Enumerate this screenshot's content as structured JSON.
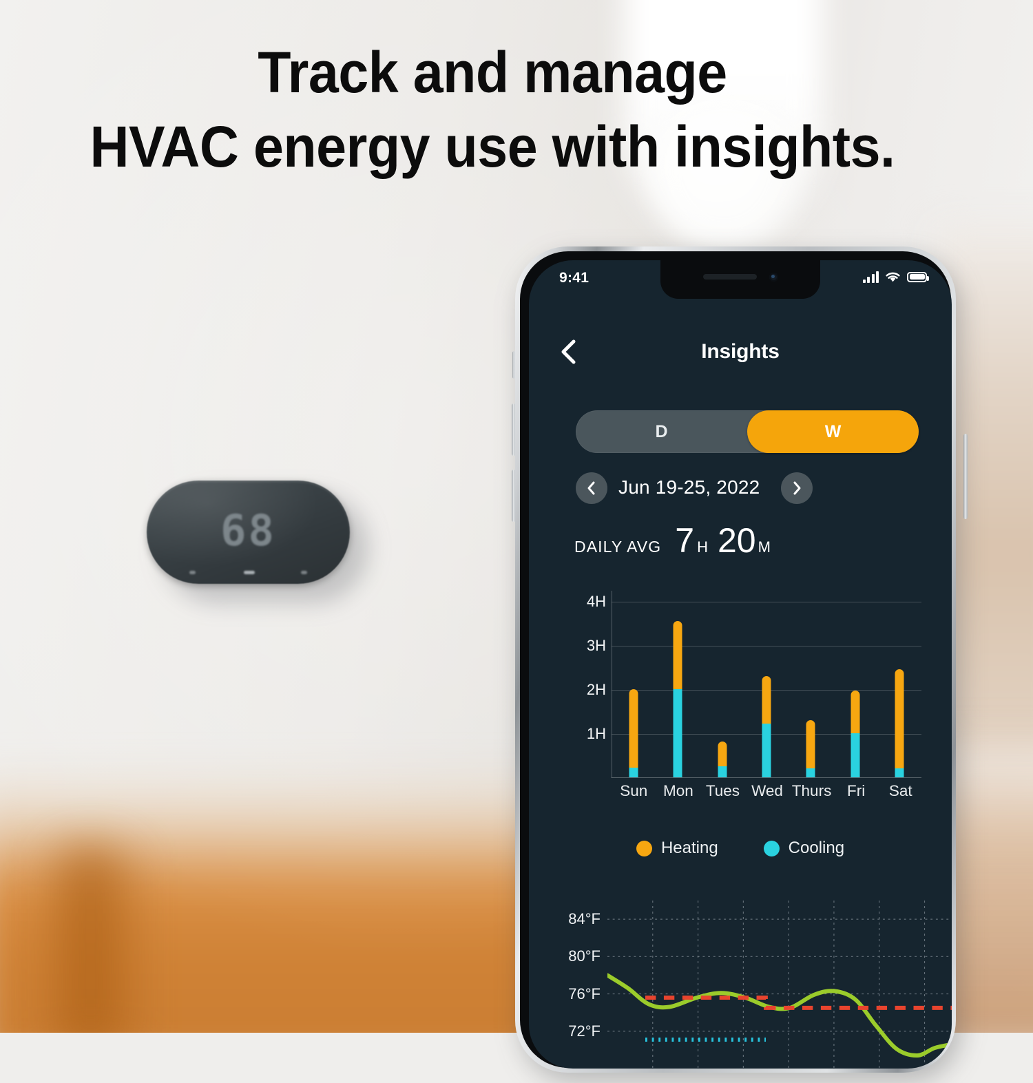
{
  "headline": {
    "line1": "Track and manage",
    "line2": "HVAC energy use with insights."
  },
  "device": {
    "name": "thermostat",
    "display_temperature": "68"
  },
  "phone": {
    "status_bar": {
      "time": "9:41",
      "signal_icon": "cellular-signal-icon",
      "wifi_icon": "wifi-icon",
      "battery_icon": "battery-full-icon"
    },
    "nav": {
      "back_icon": "chevron-left-icon",
      "title": "Insights"
    },
    "range_toggle": {
      "options": [
        {
          "label": "D",
          "active": false
        },
        {
          "label": "W",
          "active": true
        }
      ],
      "active_color": "#f5a50b",
      "track_color": "#4a565c"
    },
    "date_nav": {
      "prev_icon": "chevron-left-icon",
      "next_icon": "chevron-right-icon",
      "label": "Jun 19-25,  2022"
    },
    "daily_average": {
      "label": "DAILY AVG",
      "hours": "7",
      "hours_unit": "H",
      "minutes": "20",
      "minutes_unit": "M"
    },
    "legend": [
      {
        "label": "Heating",
        "color": "#f7a711"
      },
      {
        "label": "Cooling",
        "color": "#2ad2e0"
      }
    ],
    "colors": {
      "screen_background": "#16252f",
      "heating": "#f7a711",
      "cooling": "#2ad2e0",
      "accent": "#f5a50b",
      "temp_line": "#9bcc2b",
      "heat_setpoint": "#e8442e",
      "cool_setpoint": "#27c3dd"
    }
  },
  "chart_data": [
    {
      "type": "bar",
      "title": "",
      "subtitle": "",
      "xlabel": "",
      "ylabel": "",
      "stacked": true,
      "grid": true,
      "legend_position": "bottom",
      "categories": [
        "Sun",
        "Mon",
        "Tues",
        "Wed",
        "Thurs",
        "Fri",
        "Sat"
      ],
      "ytick_labels": [
        "1H",
        "2H",
        "3H",
        "4H"
      ],
      "ytick_values": [
        1,
        2,
        3,
        4
      ],
      "ylim": [
        0,
        4.25
      ],
      "series": [
        {
          "name": "Cooling",
          "color": "#2ad2e0",
          "values": [
            0.22,
            2.0,
            0.25,
            1.22,
            0.2,
            1.0,
            0.2
          ]
        },
        {
          "name": "Heating",
          "color": "#f7a711",
          "values": [
            1.78,
            1.55,
            0.57,
            1.08,
            1.1,
            0.97,
            2.25
          ]
        }
      ],
      "totals": [
        2.0,
        3.55,
        0.82,
        2.3,
        1.3,
        1.97,
        2.45
      ]
    },
    {
      "type": "line",
      "title": "",
      "ylabel": "",
      "xlabel": "",
      "grid": true,
      "ytick_labels": [
        "72°F",
        "76°F",
        "80°F",
        "84°F"
      ],
      "ytick_values": [
        72,
        76,
        80,
        84
      ],
      "ylim": [
        68,
        86
      ],
      "series": [
        {
          "name": "Indoor temperature",
          "color": "#9bcc2b",
          "style": "solid",
          "points": [
            [
              0.0,
              78.0
            ],
            [
              0.06,
              76.6
            ],
            [
              0.12,
              74.9
            ],
            [
              0.18,
              74.6
            ],
            [
              0.26,
              75.6
            ],
            [
              0.33,
              76.1
            ],
            [
              0.4,
              75.6
            ],
            [
              0.47,
              74.6
            ],
            [
              0.53,
              74.5
            ],
            [
              0.6,
              75.9
            ],
            [
              0.66,
              76.3
            ],
            [
              0.72,
              75.4
            ],
            [
              0.78,
              72.6
            ],
            [
              0.84,
              70.1
            ],
            [
              0.9,
              69.4
            ],
            [
              0.95,
              70.2
            ],
            [
              1.0,
              70.6
            ]
          ]
        },
        {
          "name": "Heating setpoint",
          "color": "#e8442e",
          "style": "dashed",
          "points": [
            [
              0.11,
              75.6
            ],
            [
              0.46,
              75.6
            ],
            [
              0.46,
              74.5
            ],
            [
              1.0,
              74.5
            ]
          ]
        },
        {
          "name": "Cooling setpoint",
          "color": "#27c3dd",
          "style": "dotted",
          "points": [
            [
              0.11,
              71.1
            ],
            [
              0.46,
              71.1
            ]
          ]
        }
      ]
    }
  ]
}
